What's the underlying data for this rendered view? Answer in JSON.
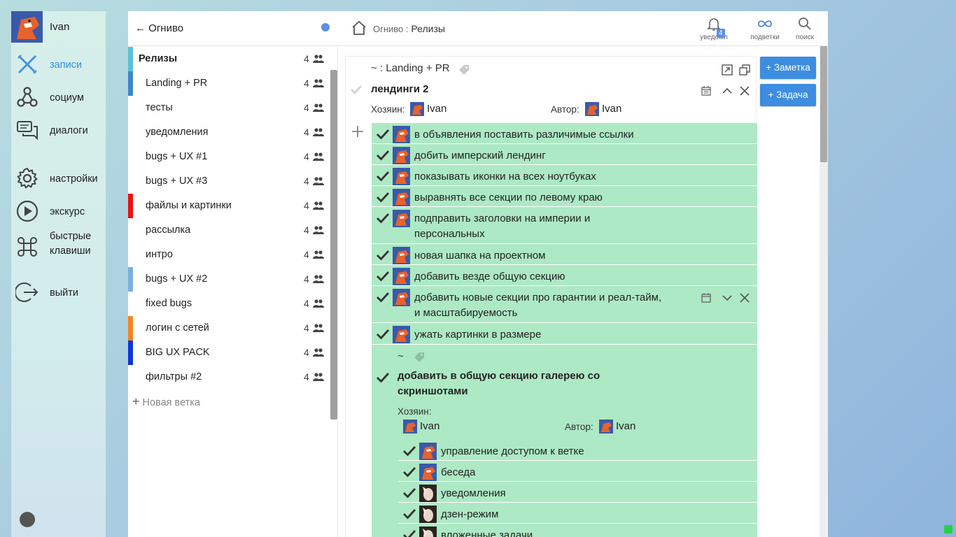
{
  "user": {
    "name": "Ivan"
  },
  "nav": [
    {
      "label": "записи",
      "icon": "notes-icon",
      "active": true
    },
    {
      "label": "социум",
      "icon": "social-icon"
    },
    {
      "label": "диалоги",
      "icon": "dialogs-icon"
    },
    {
      "label": "настройки",
      "icon": "gear-icon"
    },
    {
      "label": "экскурс",
      "icon": "play-icon"
    },
    {
      "label": "быстрые клавиши",
      "icon": "command-key-icon"
    },
    {
      "label": "выйти",
      "icon": "logout-icon"
    }
  ],
  "topbar": {
    "back_label": "← Огниво",
    "crumb_parent": "Огниво :",
    "crumb_current": "Релизы",
    "tools": [
      {
        "label": "уведомл",
        "icon": "bell-icon",
        "badge": "4"
      },
      {
        "label": "подветки",
        "icon": "infinity-icon"
      },
      {
        "label": "поиск",
        "icon": "search-icon"
      }
    ]
  },
  "branches": {
    "head": {
      "name": "Релизы",
      "count": "4"
    },
    "items": [
      {
        "name": "Landing + PR",
        "count": "4",
        "color": "#3f86c8"
      },
      {
        "name": "тесты",
        "count": "4",
        "color": ""
      },
      {
        "name": "уведомления",
        "count": "4",
        "color": ""
      },
      {
        "name": "bugs + UX #1",
        "count": "4",
        "color": ""
      },
      {
        "name": "bugs + UX #3",
        "count": "4",
        "color": ""
      },
      {
        "name": "файлы и картинки",
        "count": "4",
        "color": "#ee1111"
      },
      {
        "name": "рассылка",
        "count": "4",
        "color": ""
      },
      {
        "name": "интро",
        "count": "4",
        "color": ""
      },
      {
        "name": "bugs + UX #2",
        "count": "4",
        "color": "#7ab0e0"
      },
      {
        "name": "fixed bugs",
        "count": "4",
        "color": ""
      },
      {
        "name": "логин с сетей",
        "count": "4",
        "color": "#f5841f"
      },
      {
        "name": "BIG UX PACK",
        "count": "4",
        "color": "#1133dd"
      },
      {
        "name": "фильтры #2",
        "count": "4",
        "color": ""
      }
    ],
    "new_branch": "Новая ветка"
  },
  "card": {
    "path": "~ : Landing + PR",
    "title": "лендинги 2",
    "owner_label": "Хозяин:",
    "owner": "Ivan",
    "author_label": "Автор:",
    "author": "Ivan",
    "tasks": [
      "в объявления поставить различимые ссылки",
      "добить имперский лендинг",
      "показывать иконки на всех ноутбуках",
      "выравнять все секции по левому краю",
      "подправить заголовки на империи и|персональных",
      "новая шапка на проектном",
      "добавить везде общую секцию",
      "добавить новые секции про гарантии и реал-тайм,|и масштабируемость",
      "ужать картинки в размере"
    ],
    "subcard": {
      "path": "~",
      "title_line1": "добавить в общую секцию галерею со",
      "title_line2": "скриншотами",
      "owner_label": "Хозяин:",
      "owner": "Ivan",
      "author_label": "Автор:",
      "author": "Ivan",
      "tasks": [
        "управление доступом к ветке",
        "беседа",
        "уведомления",
        "дзен-режим",
        "вложенные задачи"
      ]
    }
  },
  "buttons": {
    "note": "+ Заметка",
    "task": "+ Задача"
  },
  "colors": {
    "accent": "#3d8de0",
    "task_bg": "#ade9c5"
  }
}
